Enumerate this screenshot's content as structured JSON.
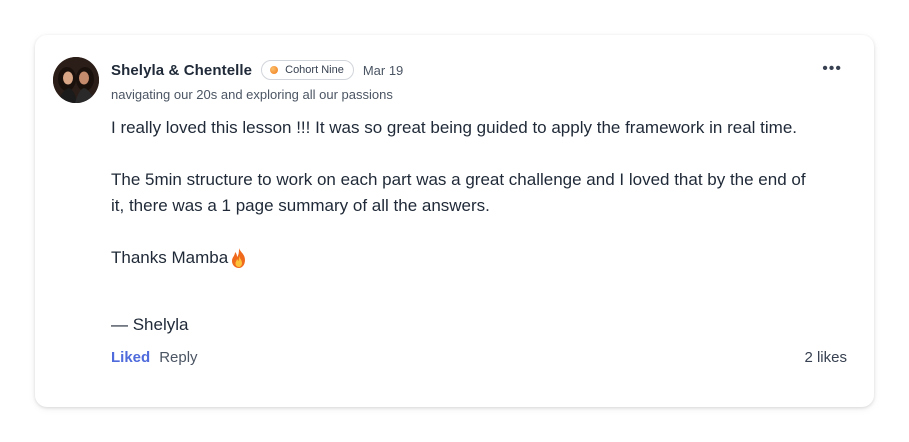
{
  "post": {
    "author": "Shelyla & Chentelle",
    "badge": "Cohort Nine",
    "date": "Mar 19",
    "subtitle": "navigating our 20s and exploring all our passions",
    "paragraph1": "I really loved this lesson !!! It was so great being guided to apply the framework in real time.",
    "paragraph2": "The 5min structure to work on each part was a great challenge and I loved that by the end of it, there was a 1 page summary of all the answers.",
    "paragraph3": "Thanks Mamba",
    "signature": "— Shelyla",
    "more_icon": "more-horizontal-icon",
    "emoji": "fire-icon"
  },
  "actions": {
    "liked_label": "Liked",
    "reply_label": "Reply",
    "likes_count": "2 likes"
  },
  "colors": {
    "accent": "#4f6bdc",
    "badge_dot": "#f07a1a"
  }
}
